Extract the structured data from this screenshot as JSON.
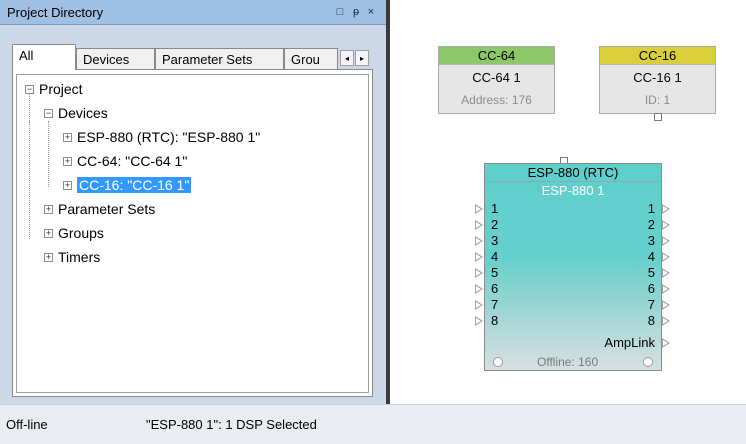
{
  "panel": {
    "title": "Project Directory",
    "title_buttons": [
      "□",
      "ᵽ",
      "×"
    ]
  },
  "tabs": [
    {
      "label": "All",
      "active": true
    },
    {
      "label": "Devices",
      "active": false
    },
    {
      "label": "Parameter Sets",
      "active": false
    },
    {
      "label": "Grou",
      "active": false
    }
  ],
  "tab_scroll": {
    "left": "◂",
    "right": "▸"
  },
  "tree": {
    "root": "Project",
    "devices": "Devices",
    "device_items": [
      "ESP-880 (RTC): \"ESP-880 1\"",
      "CC-64: \"CC-64 1\"",
      "CC-16: \"CC-16 1\""
    ],
    "selected_index": 2,
    "others": [
      "Parameter Sets",
      "Groups",
      "Timers"
    ]
  },
  "canvas": {
    "cc64": {
      "header": "CC-64",
      "name": "CC-64 1",
      "sub": "Address: 176",
      "color": "#8cc86a"
    },
    "cc16": {
      "header": "CC-16",
      "name": "CC-16 1",
      "sub": "ID: 1",
      "color": "#d9d03c"
    },
    "esp": {
      "header": "ESP-880 (RTC)",
      "name": "ESP-880 1",
      "inputs": [
        "1",
        "2",
        "3",
        "4",
        "5",
        "6",
        "7",
        "8"
      ],
      "outputs": [
        "1",
        "2",
        "3",
        "4",
        "5",
        "6",
        "7",
        "8"
      ],
      "amplink": "AmpLink",
      "status": "Offline: 160",
      "color": "#5fcfcc"
    }
  },
  "statusbar": {
    "mode": "Off-line",
    "message": "\"ESP-880 1\": 1 DSP Selected"
  }
}
